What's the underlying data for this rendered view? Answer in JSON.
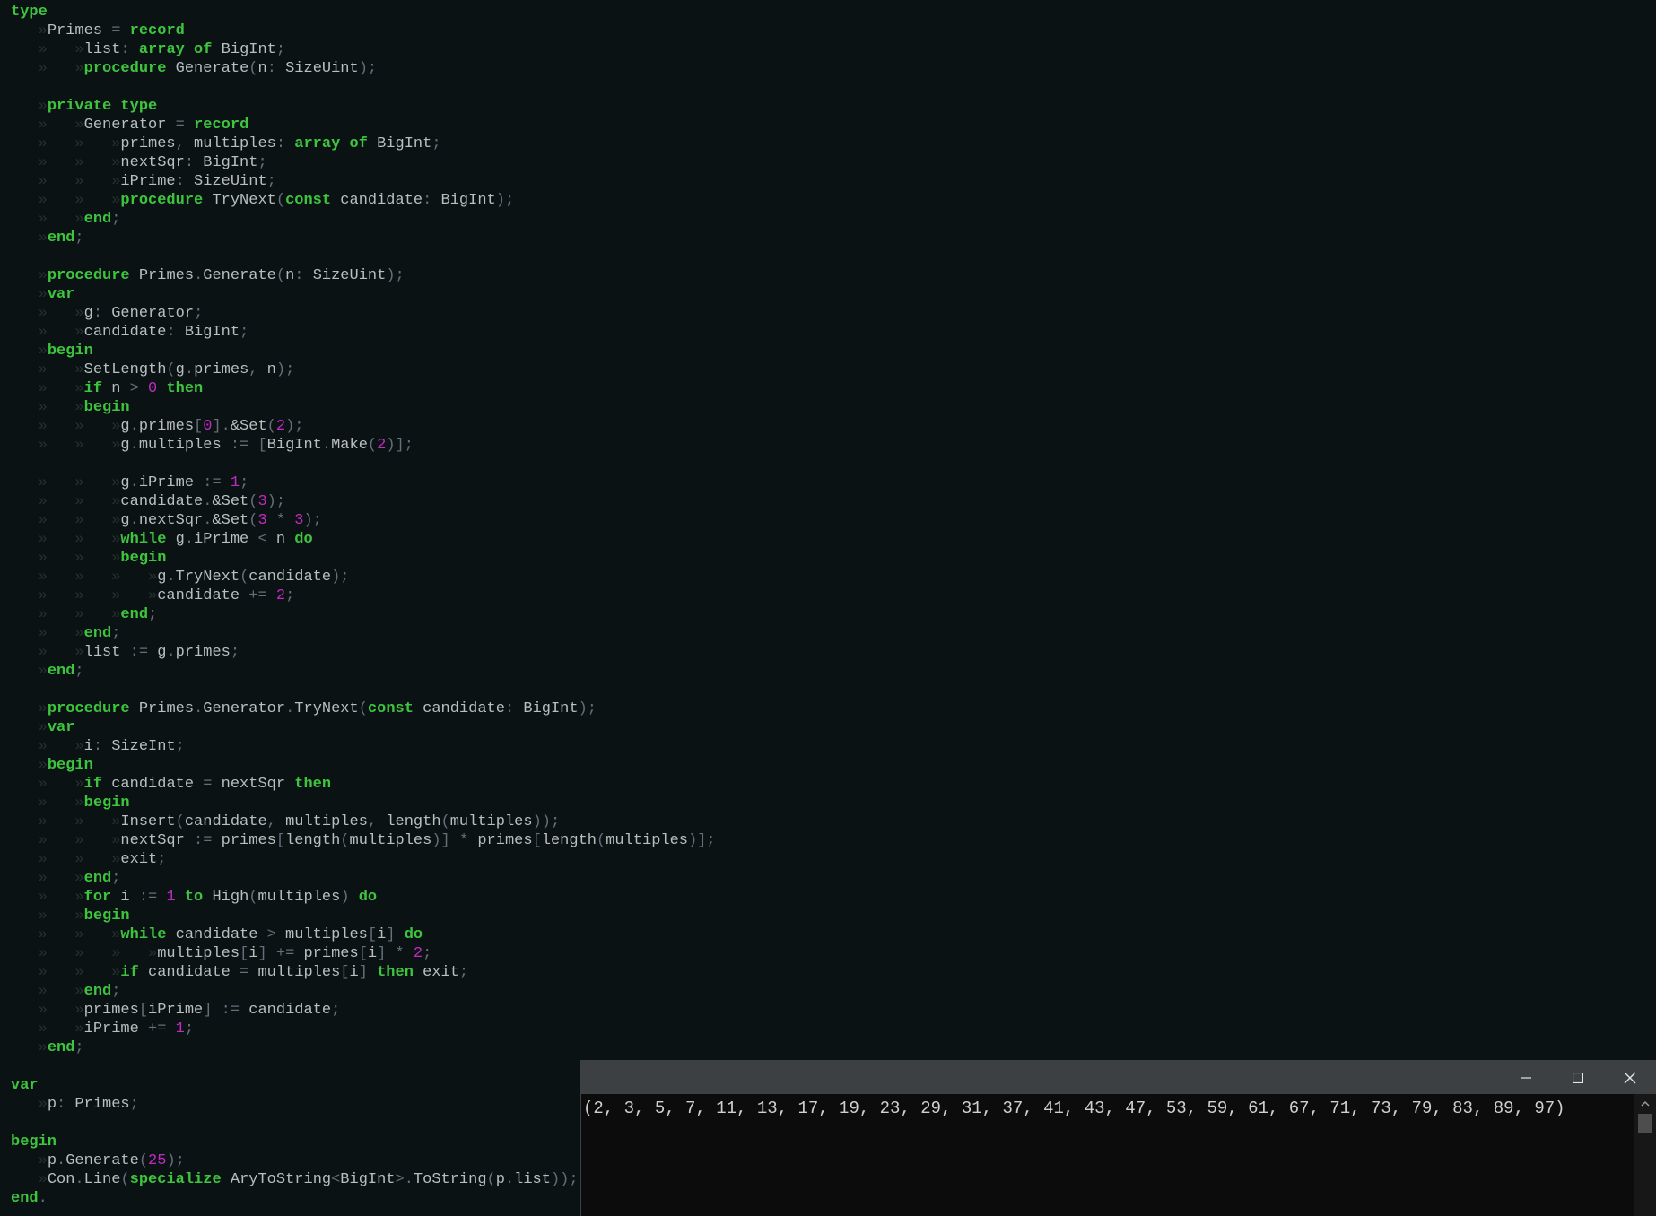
{
  "colors": {
    "background": "#0b1214",
    "identifier": "#b8bfbf",
    "keyword": "#3ec53e",
    "number": "#c22bc2",
    "punctuation": "#63707a",
    "tab_marker": "#26322f",
    "console_background": "#0c0c0c",
    "console_titlebar": "#3c4043"
  },
  "tab_marker": "»",
  "code_lines": [
    [
      [
        "k",
        "type"
      ]
    ],
    [
      [
        "t",
        1
      ],
      [
        "i",
        "Primes "
      ],
      [
        "p",
        "="
      ],
      [
        "i",
        " "
      ],
      [
        "k",
        "record"
      ]
    ],
    [
      [
        "t",
        2
      ],
      [
        "i",
        "list"
      ],
      [
        "p",
        ":"
      ],
      [
        "i",
        " "
      ],
      [
        "k",
        "array of"
      ],
      [
        "i",
        " BigInt"
      ],
      [
        "p",
        ";"
      ]
    ],
    [
      [
        "t",
        2
      ],
      [
        "k",
        "procedure"
      ],
      [
        "i",
        " Generate"
      ],
      [
        "p",
        "("
      ],
      [
        "i",
        "n"
      ],
      [
        "p",
        ":"
      ],
      [
        "i",
        " SizeUint"
      ],
      [
        "p",
        ");"
      ]
    ],
    [],
    [
      [
        "t",
        1
      ],
      [
        "k",
        "private type"
      ]
    ],
    [
      [
        "t",
        2
      ],
      [
        "i",
        "Generator "
      ],
      [
        "p",
        "="
      ],
      [
        "i",
        " "
      ],
      [
        "k",
        "record"
      ]
    ],
    [
      [
        "t",
        3
      ],
      [
        "i",
        "primes"
      ],
      [
        "p",
        ","
      ],
      [
        "i",
        " multiples"
      ],
      [
        "p",
        ":"
      ],
      [
        "i",
        " "
      ],
      [
        "k",
        "array of"
      ],
      [
        "i",
        " BigInt"
      ],
      [
        "p",
        ";"
      ]
    ],
    [
      [
        "t",
        3
      ],
      [
        "i",
        "nextSqr"
      ],
      [
        "p",
        ":"
      ],
      [
        "i",
        " BigInt"
      ],
      [
        "p",
        ";"
      ]
    ],
    [
      [
        "t",
        3
      ],
      [
        "i",
        "iPrime"
      ],
      [
        "p",
        ":"
      ],
      [
        "i",
        " SizeUint"
      ],
      [
        "p",
        ";"
      ]
    ],
    [
      [
        "t",
        3
      ],
      [
        "k",
        "procedure"
      ],
      [
        "i",
        " TryNext"
      ],
      [
        "p",
        "("
      ],
      [
        "k",
        "const"
      ],
      [
        "i",
        " candidate"
      ],
      [
        "p",
        ":"
      ],
      [
        "i",
        " BigInt"
      ],
      [
        "p",
        ");"
      ]
    ],
    [
      [
        "t",
        2
      ],
      [
        "k",
        "end"
      ],
      [
        "p",
        ";"
      ]
    ],
    [
      [
        "t",
        1
      ],
      [
        "k",
        "end"
      ],
      [
        "p",
        ";"
      ]
    ],
    [],
    [
      [
        "t",
        1
      ],
      [
        "k",
        "procedure"
      ],
      [
        "i",
        " Primes"
      ],
      [
        "p",
        "."
      ],
      [
        "i",
        "Generate"
      ],
      [
        "p",
        "("
      ],
      [
        "i",
        "n"
      ],
      [
        "p",
        ":"
      ],
      [
        "i",
        " SizeUint"
      ],
      [
        "p",
        ");"
      ]
    ],
    [
      [
        "t",
        1
      ],
      [
        "k",
        "var"
      ]
    ],
    [
      [
        "t",
        2
      ],
      [
        "i",
        "g"
      ],
      [
        "p",
        ":"
      ],
      [
        "i",
        " Generator"
      ],
      [
        "p",
        ";"
      ]
    ],
    [
      [
        "t",
        2
      ],
      [
        "i",
        "candidate"
      ],
      [
        "p",
        ":"
      ],
      [
        "i",
        " BigInt"
      ],
      [
        "p",
        ";"
      ]
    ],
    [
      [
        "t",
        1
      ],
      [
        "k",
        "begin"
      ]
    ],
    [
      [
        "t",
        2
      ],
      [
        "i",
        "SetLength"
      ],
      [
        "p",
        "("
      ],
      [
        "i",
        "g"
      ],
      [
        "p",
        "."
      ],
      [
        "i",
        "primes"
      ],
      [
        "p",
        ","
      ],
      [
        "i",
        " n"
      ],
      [
        "p",
        ");"
      ]
    ],
    [
      [
        "t",
        2
      ],
      [
        "k",
        "if"
      ],
      [
        "i",
        " n "
      ],
      [
        "p",
        ">"
      ],
      [
        "i",
        " "
      ],
      [
        "n",
        "0"
      ],
      [
        "i",
        " "
      ],
      [
        "k",
        "then"
      ]
    ],
    [
      [
        "t",
        2
      ],
      [
        "k",
        "begin"
      ]
    ],
    [
      [
        "t",
        3
      ],
      [
        "i",
        "g"
      ],
      [
        "p",
        "."
      ],
      [
        "i",
        "primes"
      ],
      [
        "p",
        "["
      ],
      [
        "n",
        "0"
      ],
      [
        "p",
        "]."
      ],
      [
        "i",
        "&Set"
      ],
      [
        "p",
        "("
      ],
      [
        "n",
        "2"
      ],
      [
        "p",
        ");"
      ]
    ],
    [
      [
        "t",
        3
      ],
      [
        "i",
        "g"
      ],
      [
        "p",
        "."
      ],
      [
        "i",
        "multiples "
      ],
      [
        "p",
        ":="
      ],
      [
        "i",
        " "
      ],
      [
        "p",
        "["
      ],
      [
        "i",
        "BigInt"
      ],
      [
        "p",
        "."
      ],
      [
        "i",
        "Make"
      ],
      [
        "p",
        "("
      ],
      [
        "n",
        "2"
      ],
      [
        "p",
        ")];"
      ]
    ],
    [],
    [
      [
        "t",
        3
      ],
      [
        "i",
        "g"
      ],
      [
        "p",
        "."
      ],
      [
        "i",
        "iPrime "
      ],
      [
        "p",
        ":="
      ],
      [
        "i",
        " "
      ],
      [
        "n",
        "1"
      ],
      [
        "p",
        ";"
      ]
    ],
    [
      [
        "t",
        3
      ],
      [
        "i",
        "candidate"
      ],
      [
        "p",
        "."
      ],
      [
        "i",
        "&Set"
      ],
      [
        "p",
        "("
      ],
      [
        "n",
        "3"
      ],
      [
        "p",
        ");"
      ]
    ],
    [
      [
        "t",
        3
      ],
      [
        "i",
        "g"
      ],
      [
        "p",
        "."
      ],
      [
        "i",
        "nextSqr"
      ],
      [
        "p",
        "."
      ],
      [
        "i",
        "&Set"
      ],
      [
        "p",
        "("
      ],
      [
        "n",
        "3"
      ],
      [
        "i",
        " "
      ],
      [
        "p",
        "*"
      ],
      [
        "i",
        " "
      ],
      [
        "n",
        "3"
      ],
      [
        "p",
        ");"
      ]
    ],
    [
      [
        "t",
        3
      ],
      [
        "k",
        "while"
      ],
      [
        "i",
        " g"
      ],
      [
        "p",
        "."
      ],
      [
        "i",
        "iPrime "
      ],
      [
        "p",
        "<"
      ],
      [
        "i",
        " n "
      ],
      [
        "k",
        "do"
      ]
    ],
    [
      [
        "t",
        3
      ],
      [
        "k",
        "begin"
      ]
    ],
    [
      [
        "t",
        4
      ],
      [
        "i",
        "g"
      ],
      [
        "p",
        "."
      ],
      [
        "i",
        "TryNext"
      ],
      [
        "p",
        "("
      ],
      [
        "i",
        "candidate"
      ],
      [
        "p",
        ");"
      ]
    ],
    [
      [
        "t",
        4
      ],
      [
        "i",
        "candidate "
      ],
      [
        "p",
        "+="
      ],
      [
        "i",
        " "
      ],
      [
        "n",
        "2"
      ],
      [
        "p",
        ";"
      ]
    ],
    [
      [
        "t",
        3
      ],
      [
        "k",
        "end"
      ],
      [
        "p",
        ";"
      ]
    ],
    [
      [
        "t",
        2
      ],
      [
        "k",
        "end"
      ],
      [
        "p",
        ";"
      ]
    ],
    [
      [
        "t",
        2
      ],
      [
        "i",
        "list "
      ],
      [
        "p",
        ":="
      ],
      [
        "i",
        " g"
      ],
      [
        "p",
        "."
      ],
      [
        "i",
        "primes"
      ],
      [
        "p",
        ";"
      ]
    ],
    [
      [
        "t",
        1
      ],
      [
        "k",
        "end"
      ],
      [
        "p",
        ";"
      ]
    ],
    [],
    [
      [
        "t",
        1
      ],
      [
        "k",
        "procedure"
      ],
      [
        "i",
        " Primes"
      ],
      [
        "p",
        "."
      ],
      [
        "i",
        "Generator"
      ],
      [
        "p",
        "."
      ],
      [
        "i",
        "TryNext"
      ],
      [
        "p",
        "("
      ],
      [
        "k",
        "const"
      ],
      [
        "i",
        " candidate"
      ],
      [
        "p",
        ":"
      ],
      [
        "i",
        " BigInt"
      ],
      [
        "p",
        ");"
      ]
    ],
    [
      [
        "t",
        1
      ],
      [
        "k",
        "var"
      ]
    ],
    [
      [
        "t",
        2
      ],
      [
        "i",
        "i"
      ],
      [
        "p",
        ":"
      ],
      [
        "i",
        " SizeInt"
      ],
      [
        "p",
        ";"
      ]
    ],
    [
      [
        "t",
        1
      ],
      [
        "k",
        "begin"
      ]
    ],
    [
      [
        "t",
        2
      ],
      [
        "k",
        "if"
      ],
      [
        "i",
        " candidate "
      ],
      [
        "p",
        "="
      ],
      [
        "i",
        " nextSqr "
      ],
      [
        "k",
        "then"
      ]
    ],
    [
      [
        "t",
        2
      ],
      [
        "k",
        "begin"
      ]
    ],
    [
      [
        "t",
        3
      ],
      [
        "i",
        "Insert"
      ],
      [
        "p",
        "("
      ],
      [
        "i",
        "candidate"
      ],
      [
        "p",
        ","
      ],
      [
        "i",
        " multiples"
      ],
      [
        "p",
        ","
      ],
      [
        "i",
        " length"
      ],
      [
        "p",
        "("
      ],
      [
        "i",
        "multiples"
      ],
      [
        "p",
        "));"
      ]
    ],
    [
      [
        "t",
        3
      ],
      [
        "i",
        "nextSqr "
      ],
      [
        "p",
        ":="
      ],
      [
        "i",
        " primes"
      ],
      [
        "p",
        "["
      ],
      [
        "i",
        "length"
      ],
      [
        "p",
        "("
      ],
      [
        "i",
        "multiples"
      ],
      [
        "p",
        ")]"
      ],
      [
        "i",
        " "
      ],
      [
        "p",
        "*"
      ],
      [
        "i",
        " primes"
      ],
      [
        "p",
        "["
      ],
      [
        "i",
        "length"
      ],
      [
        "p",
        "("
      ],
      [
        "i",
        "multiples"
      ],
      [
        "p",
        ")];"
      ]
    ],
    [
      [
        "t",
        3
      ],
      [
        "i",
        "exit"
      ],
      [
        "p",
        ";"
      ]
    ],
    [
      [
        "t",
        2
      ],
      [
        "k",
        "end"
      ],
      [
        "p",
        ";"
      ]
    ],
    [
      [
        "t",
        2
      ],
      [
        "k",
        "for"
      ],
      [
        "i",
        " i "
      ],
      [
        "p",
        ":="
      ],
      [
        "i",
        " "
      ],
      [
        "n",
        "1"
      ],
      [
        "i",
        " "
      ],
      [
        "k",
        "to"
      ],
      [
        "i",
        " High"
      ],
      [
        "p",
        "("
      ],
      [
        "i",
        "multiples"
      ],
      [
        "p",
        ")"
      ],
      [
        "i",
        " "
      ],
      [
        "k",
        "do"
      ]
    ],
    [
      [
        "t",
        2
      ],
      [
        "k",
        "begin"
      ]
    ],
    [
      [
        "t",
        3
      ],
      [
        "k",
        "while"
      ],
      [
        "i",
        " candidate "
      ],
      [
        "p",
        ">"
      ],
      [
        "i",
        " multiples"
      ],
      [
        "p",
        "["
      ],
      [
        "i",
        "i"
      ],
      [
        "p",
        "]"
      ],
      [
        "i",
        " "
      ],
      [
        "k",
        "do"
      ]
    ],
    [
      [
        "t",
        4
      ],
      [
        "i",
        "multiples"
      ],
      [
        "p",
        "["
      ],
      [
        "i",
        "i"
      ],
      [
        "p",
        "]"
      ],
      [
        "i",
        " "
      ],
      [
        "p",
        "+="
      ],
      [
        "i",
        " primes"
      ],
      [
        "p",
        "["
      ],
      [
        "i",
        "i"
      ],
      [
        "p",
        "]"
      ],
      [
        "i",
        " "
      ],
      [
        "p",
        "*"
      ],
      [
        "i",
        " "
      ],
      [
        "n",
        "2"
      ],
      [
        "p",
        ";"
      ]
    ],
    [
      [
        "t",
        3
      ],
      [
        "k",
        "if"
      ],
      [
        "i",
        " candidate "
      ],
      [
        "p",
        "="
      ],
      [
        "i",
        " multiples"
      ],
      [
        "p",
        "["
      ],
      [
        "i",
        "i"
      ],
      [
        "p",
        "]"
      ],
      [
        "i",
        " "
      ],
      [
        "k",
        "then"
      ],
      [
        "i",
        " exit"
      ],
      [
        "p",
        ";"
      ]
    ],
    [
      [
        "t",
        2
      ],
      [
        "k",
        "end"
      ],
      [
        "p",
        ";"
      ]
    ],
    [
      [
        "t",
        2
      ],
      [
        "i",
        "primes"
      ],
      [
        "p",
        "["
      ],
      [
        "i",
        "iPrime"
      ],
      [
        "p",
        "]"
      ],
      [
        "i",
        " "
      ],
      [
        "p",
        ":="
      ],
      [
        "i",
        " candidate"
      ],
      [
        "p",
        ";"
      ]
    ],
    [
      [
        "t",
        2
      ],
      [
        "i",
        "iPrime "
      ],
      [
        "p",
        "+="
      ],
      [
        "i",
        " "
      ],
      [
        "n",
        "1"
      ],
      [
        "p",
        ";"
      ]
    ],
    [
      [
        "t",
        1
      ],
      [
        "k",
        "end"
      ],
      [
        "p",
        ";"
      ]
    ],
    [],
    [
      [
        "k",
        "var"
      ]
    ],
    [
      [
        "t",
        1
      ],
      [
        "i",
        "p"
      ],
      [
        "p",
        ":"
      ],
      [
        "i",
        " Primes"
      ],
      [
        "p",
        ";"
      ]
    ],
    [],
    [
      [
        "k",
        "begin"
      ]
    ],
    [
      [
        "t",
        1
      ],
      [
        "i",
        "p"
      ],
      [
        "p",
        "."
      ],
      [
        "i",
        "Generate"
      ],
      [
        "p",
        "("
      ],
      [
        "n",
        "25"
      ],
      [
        "p",
        ");"
      ]
    ],
    [
      [
        "t",
        1
      ],
      [
        "i",
        "Con"
      ],
      [
        "p",
        "."
      ],
      [
        "i",
        "Line"
      ],
      [
        "p",
        "("
      ],
      [
        "k",
        "specialize"
      ],
      [
        "i",
        " AryToString"
      ],
      [
        "p",
        "<"
      ],
      [
        "i",
        "BigInt"
      ],
      [
        "p",
        ">."
      ],
      [
        "i",
        "ToString"
      ],
      [
        "p",
        "("
      ],
      [
        "i",
        "p"
      ],
      [
        "p",
        "."
      ],
      [
        "i",
        "list"
      ],
      [
        "p",
        "));"
      ]
    ],
    [
      [
        "k",
        "end"
      ],
      [
        "p",
        "."
      ]
    ]
  ],
  "console": {
    "output": "(2, 3, 5, 7, 11, 13, 17, 19, 23, 29, 31, 37, 41, 43, 47, 53, 59, 61, 67, 71, 73, 79, 83, 89, 97)",
    "icons": {
      "minimize": "minimize-icon",
      "maximize": "maximize-icon",
      "close": "close-icon",
      "scroll_up": "chevron-up-icon"
    }
  }
}
